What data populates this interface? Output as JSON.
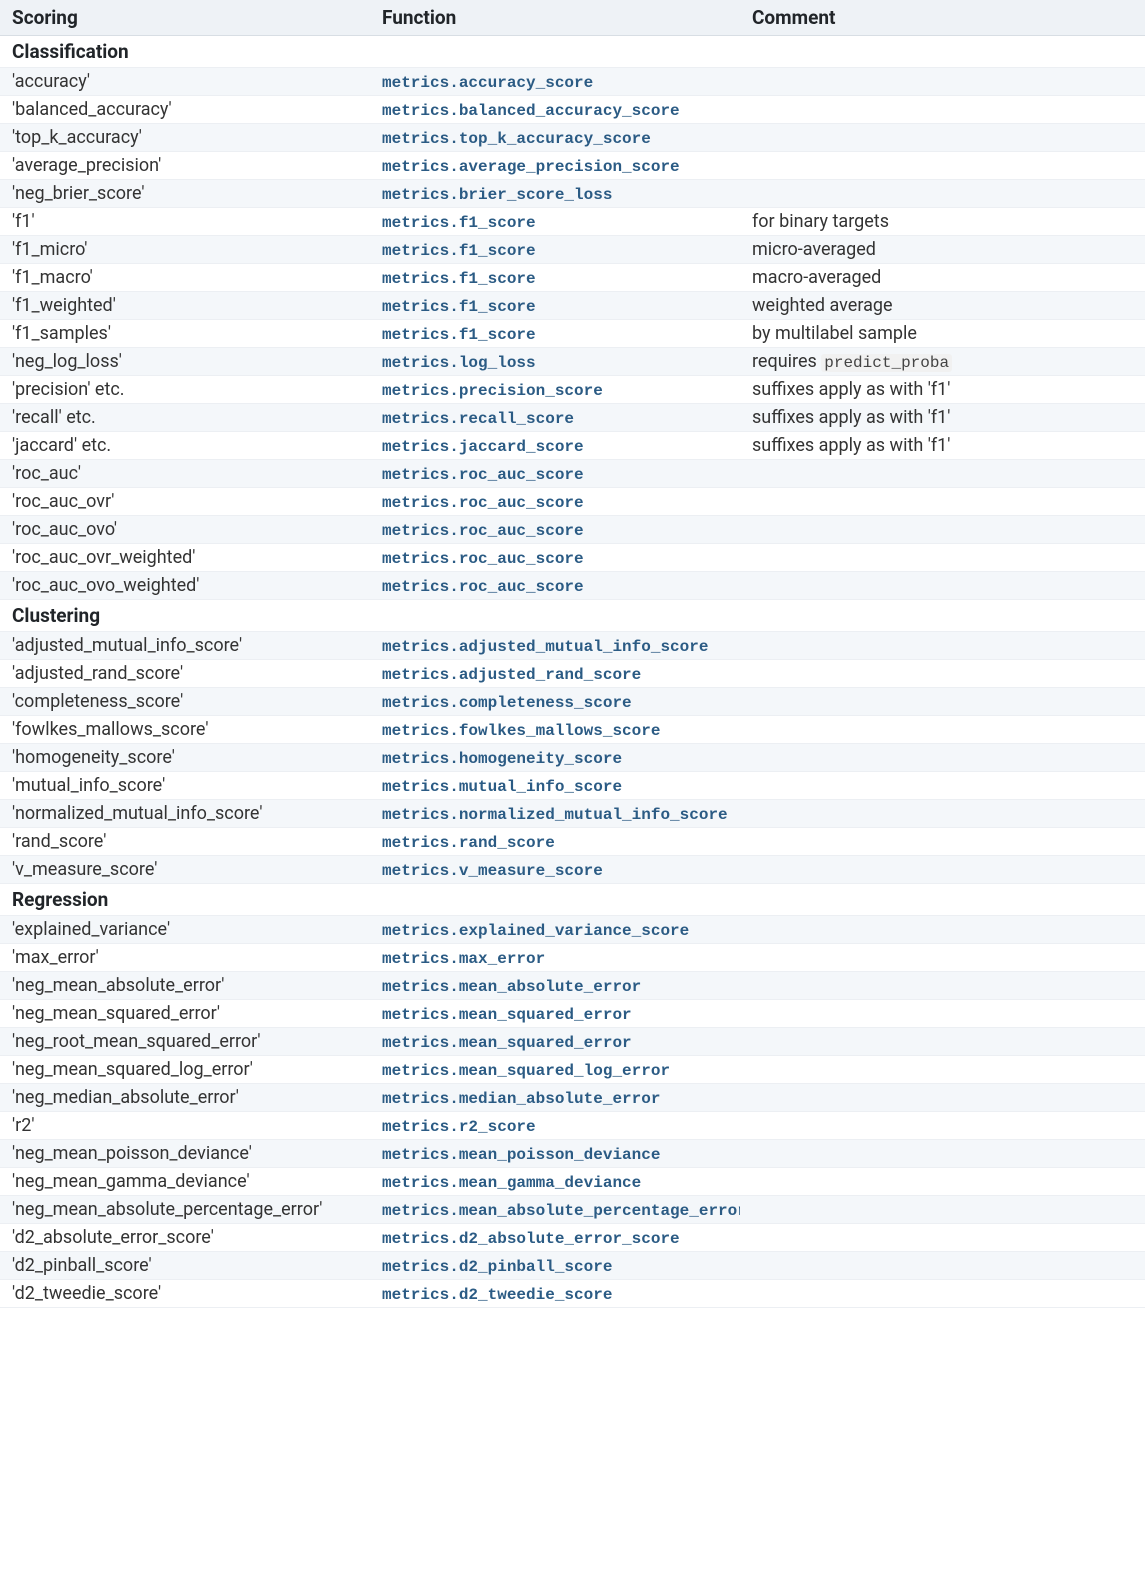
{
  "headers": {
    "scoring": "Scoring",
    "function": "Function",
    "comment": "Comment"
  },
  "sections": [
    {
      "title": "Classification",
      "rows": [
        {
          "scoring": "'accuracy'",
          "function": "metrics.accuracy_score",
          "comment": ""
        },
        {
          "scoring": "'balanced_accuracy'",
          "function": "metrics.balanced_accuracy_score",
          "comment": ""
        },
        {
          "scoring": "'top_k_accuracy'",
          "function": "metrics.top_k_accuracy_score",
          "comment": ""
        },
        {
          "scoring": "'average_precision'",
          "function": "metrics.average_precision_score",
          "comment": ""
        },
        {
          "scoring": "'neg_brier_score'",
          "function": "metrics.brier_score_loss",
          "comment": ""
        },
        {
          "scoring": "'f1'",
          "function": "metrics.f1_score",
          "comment": "for binary targets"
        },
        {
          "scoring": "'f1_micro'",
          "function": "metrics.f1_score",
          "comment": "micro-averaged"
        },
        {
          "scoring": "'f1_macro'",
          "function": "metrics.f1_score",
          "comment": "macro-averaged"
        },
        {
          "scoring": "'f1_weighted'",
          "function": "metrics.f1_score",
          "comment": "weighted average"
        },
        {
          "scoring": "'f1_samples'",
          "function": "metrics.f1_score",
          "comment": "by multilabel sample"
        },
        {
          "scoring": "'neg_log_loss'",
          "function": "metrics.log_loss",
          "comment": "requires ",
          "comment_code": "predict_proba"
        },
        {
          "scoring": "'precision' etc.",
          "function": "metrics.precision_score",
          "comment": "suffixes apply as with 'f1'"
        },
        {
          "scoring": "'recall' etc.",
          "function": "metrics.recall_score",
          "comment": "suffixes apply as with 'f1'"
        },
        {
          "scoring": "'jaccard' etc.",
          "function": "metrics.jaccard_score",
          "comment": "suffixes apply as with 'f1'"
        },
        {
          "scoring": "'roc_auc'",
          "function": "metrics.roc_auc_score",
          "comment": ""
        },
        {
          "scoring": "'roc_auc_ovr'",
          "function": "metrics.roc_auc_score",
          "comment": ""
        },
        {
          "scoring": "'roc_auc_ovo'",
          "function": "metrics.roc_auc_score",
          "comment": ""
        },
        {
          "scoring": "'roc_auc_ovr_weighted'",
          "function": "metrics.roc_auc_score",
          "comment": ""
        },
        {
          "scoring": "'roc_auc_ovo_weighted'",
          "function": "metrics.roc_auc_score",
          "comment": ""
        }
      ]
    },
    {
      "title": "Clustering",
      "rows": [
        {
          "scoring": "'adjusted_mutual_info_score'",
          "function": "metrics.adjusted_mutual_info_score",
          "comment": ""
        },
        {
          "scoring": "'adjusted_rand_score'",
          "function": "metrics.adjusted_rand_score",
          "comment": ""
        },
        {
          "scoring": "'completeness_score'",
          "function": "metrics.completeness_score",
          "comment": ""
        },
        {
          "scoring": "'fowlkes_mallows_score'",
          "function": "metrics.fowlkes_mallows_score",
          "comment": ""
        },
        {
          "scoring": "'homogeneity_score'",
          "function": "metrics.homogeneity_score",
          "comment": ""
        },
        {
          "scoring": "'mutual_info_score'",
          "function": "metrics.mutual_info_score",
          "comment": ""
        },
        {
          "scoring": "'normalized_mutual_info_score'",
          "function": "metrics.normalized_mutual_info_score",
          "comment": ""
        },
        {
          "scoring": "'rand_score'",
          "function": "metrics.rand_score",
          "comment": ""
        },
        {
          "scoring": "'v_measure_score'",
          "function": "metrics.v_measure_score",
          "comment": ""
        }
      ]
    },
    {
      "title": "Regression",
      "rows": [
        {
          "scoring": "'explained_variance'",
          "function": "metrics.explained_variance_score",
          "comment": ""
        },
        {
          "scoring": "'max_error'",
          "function": "metrics.max_error",
          "comment": ""
        },
        {
          "scoring": "'neg_mean_absolute_error'",
          "function": "metrics.mean_absolute_error",
          "comment": ""
        },
        {
          "scoring": "'neg_mean_squared_error'",
          "function": "metrics.mean_squared_error",
          "comment": ""
        },
        {
          "scoring": "'neg_root_mean_squared_error'",
          "function": "metrics.mean_squared_error",
          "comment": ""
        },
        {
          "scoring": "'neg_mean_squared_log_error'",
          "function": "metrics.mean_squared_log_error",
          "comment": ""
        },
        {
          "scoring": "'neg_median_absolute_error'",
          "function": "metrics.median_absolute_error",
          "comment": ""
        },
        {
          "scoring": "'r2'",
          "function": "metrics.r2_score",
          "comment": ""
        },
        {
          "scoring": "'neg_mean_poisson_deviance'",
          "function": "metrics.mean_poisson_deviance",
          "comment": ""
        },
        {
          "scoring": "'neg_mean_gamma_deviance'",
          "function": "metrics.mean_gamma_deviance",
          "comment": ""
        },
        {
          "scoring": "'neg_mean_absolute_percentage_error'",
          "function": "metrics.mean_absolute_percentage_error",
          "comment": ""
        },
        {
          "scoring": "'d2_absolute_error_score'",
          "function": "metrics.d2_absolute_error_score",
          "comment": ""
        },
        {
          "scoring": "'d2_pinball_score'",
          "function": "metrics.d2_pinball_score",
          "comment": ""
        },
        {
          "scoring": "'d2_tweedie_score'",
          "function": "metrics.d2_tweedie_score",
          "comment": ""
        }
      ]
    }
  ]
}
